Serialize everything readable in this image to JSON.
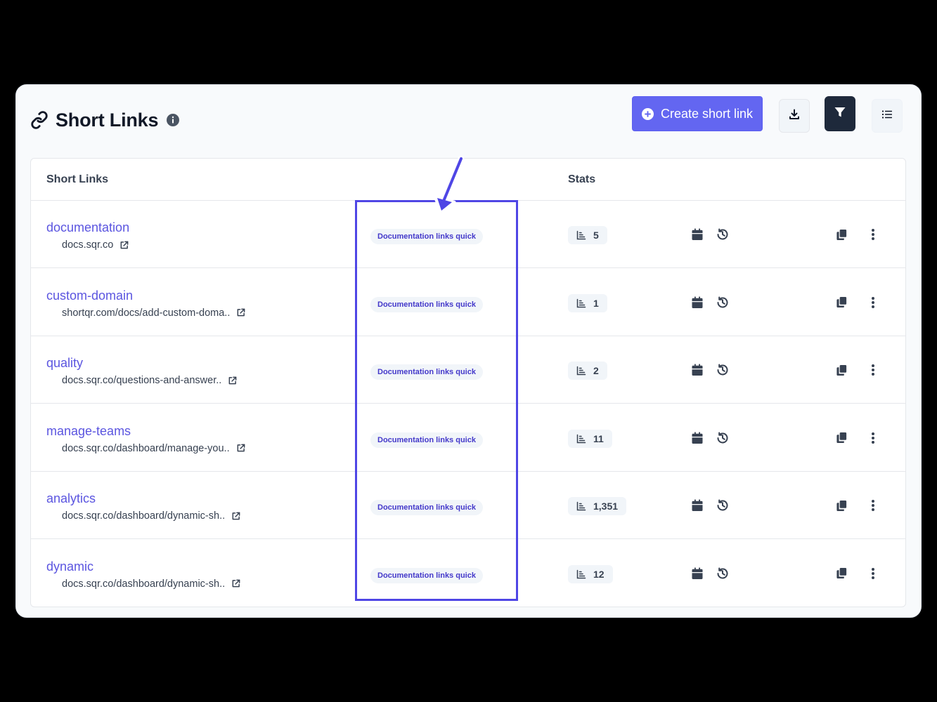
{
  "header": {
    "title": "Short Links",
    "create_button_label": "Create short link"
  },
  "table": {
    "columns": {
      "links": "Short Links",
      "stats": "Stats"
    },
    "rows": [
      {
        "slug": "documentation",
        "destination": "docs.sqr.co",
        "tag": "Documentation links quick",
        "stat": "5"
      },
      {
        "slug": "custom-domain",
        "destination": "shortqr.com/docs/add-custom-doma..",
        "tag": "Documentation links quick",
        "stat": "1"
      },
      {
        "slug": "quality",
        "destination": "docs.sqr.co/questions-and-answer..",
        "tag": "Documentation links quick",
        "stat": "2"
      },
      {
        "slug": "manage-teams",
        "destination": "docs.sqr.co/dashboard/manage-you..",
        "tag": "Documentation links quick",
        "stat": "11"
      },
      {
        "slug": "analytics",
        "destination": "docs.sqr.co/dashboard/dynamic-sh..",
        "tag": "Documentation links quick",
        "stat": "1,351"
      },
      {
        "slug": "dynamic",
        "destination": "docs.sqr.co/dashboard/dynamic-sh..",
        "tag": "Documentation links quick",
        "stat": "12"
      }
    ]
  },
  "icons": {
    "title": "link-icon",
    "info": "info-icon",
    "create": "plus-circle-icon",
    "download": "download-icon",
    "filter": "filter-icon",
    "list": "list-icon",
    "external": "external-link-icon",
    "stats": "bar-chart-icon",
    "calendar": "calendar-icon",
    "history": "history-icon",
    "copy": "copy-icon",
    "more": "more-vertical-icon"
  },
  "colors": {
    "accent": "#6366f1",
    "link_text": "#5b55e0",
    "tag_text": "#4338ca",
    "highlight": "#4f46e5",
    "filter_button": "#1e293b"
  }
}
